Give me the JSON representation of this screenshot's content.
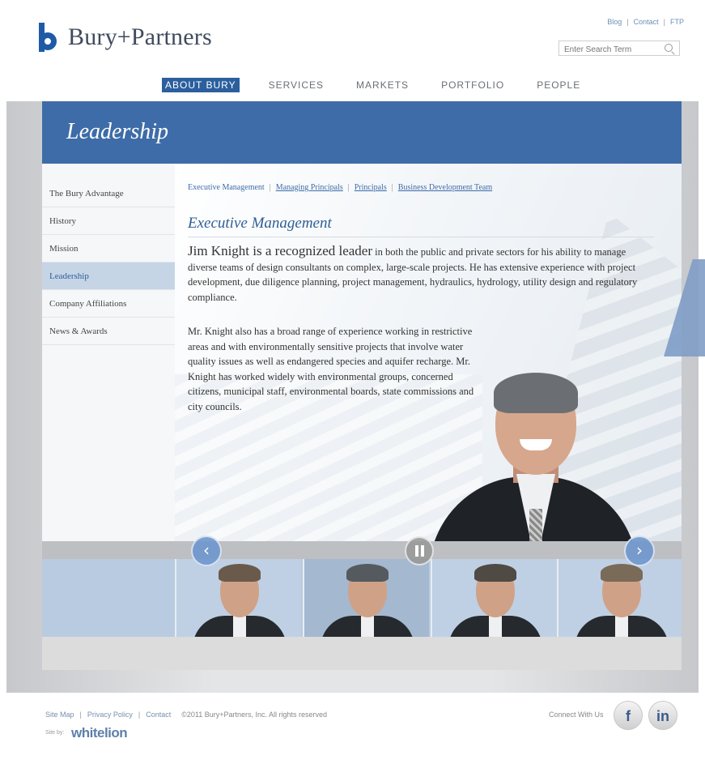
{
  "brand": {
    "name": "Bury+Partners"
  },
  "toplinks": {
    "blog": "Blog",
    "contact": "Contact",
    "ftp": "FTP"
  },
  "search": {
    "placeholder": "Enter Search Term"
  },
  "nav": [
    {
      "label": "ABOUT BURY",
      "active": true
    },
    {
      "label": "SERVICES"
    },
    {
      "label": "MARKETS"
    },
    {
      "label": "PORTFOLIO"
    },
    {
      "label": "PEOPLE"
    }
  ],
  "page": {
    "title": "Leadership"
  },
  "sidebar": [
    {
      "label": "The Bury Advantage"
    },
    {
      "label": "History"
    },
    {
      "label": "Mission"
    },
    {
      "label": "Leadership",
      "active": true
    },
    {
      "label": "Company Affiliations"
    },
    {
      "label": "News & Awards"
    }
  ],
  "subnav": [
    {
      "label": "Executive Management"
    },
    {
      "label": "Managing Principals"
    },
    {
      "label": "Principals"
    },
    {
      "label": "Business Development Team"
    }
  ],
  "section": {
    "title": "Executive Management",
    "lead_big": "Jim Knight is a recognized leader",
    "lead_rest": " in both the public and private sectors for his ability to manage diverse teams of design consultants on complex, large-scale projects. He has extensive experience with project development, due diligence planning, project management, hydraulics, hydrology, utility design and regulatory compliance.",
    "para": "Mr. Knight also has a broad range of experience working in restrictive areas and with environmentally sensitive projects that involve water quality issues as well as endangered species and aquifer recharge. Mr. Knight has worked widely with environmental groups, concerned citizens, municipal staff, environmental boards, state commissions and city councils."
  },
  "carousel": {
    "prev": "‹",
    "next": "›"
  },
  "footer": {
    "sitemap": "Site Map",
    "privacy": "Privacy Policy",
    "contact": "Contact",
    "copyright": "©2011 Bury+Partners, Inc. All rights reserved",
    "siteby": "Site by:",
    "agency": "whitelion",
    "connect": "Connect With Us",
    "facebook": "f",
    "linkedin": "in"
  },
  "colors": {
    "brand_blue": "#3e6ca8",
    "accent_light": "#c5d5e6"
  }
}
